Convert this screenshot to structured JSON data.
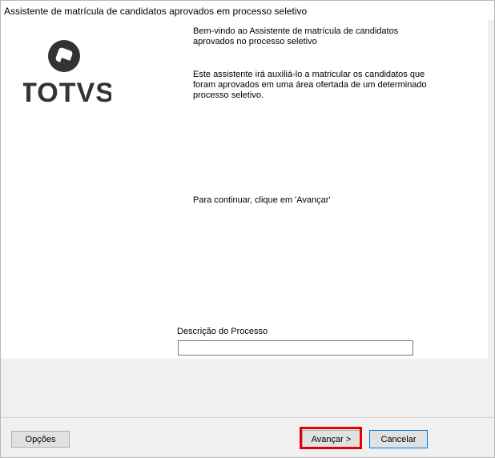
{
  "window": {
    "title": "Assistente de matrícula de candidatos aprovados em processo seletivo"
  },
  "logo": {
    "text": "TOTVS",
    "icon": "totvs-logo-icon",
    "color": "#333333"
  },
  "welcome": {
    "heading_line1": "Bem-vindo ao Assistente de matrícula de candidatos",
    "heading_line2": "aprovados no processo seletivo",
    "desc_line1": "Este assistente irá auxiliá-lo a matricular os candidatos que",
    "desc_line2": "foram aprovados em uma área ofertada de um determinado",
    "desc_line3": "processo seletivo.",
    "continue": "Para continuar, clique em 'Avançar'"
  },
  "process": {
    "label": "Descrição do Processo",
    "value": ""
  },
  "buttons": {
    "options": "Opções",
    "next": "Avançar >",
    "cancel": "Cancelar"
  },
  "colors": {
    "highlight": "#e60000",
    "focus_border": "#0078d7"
  }
}
